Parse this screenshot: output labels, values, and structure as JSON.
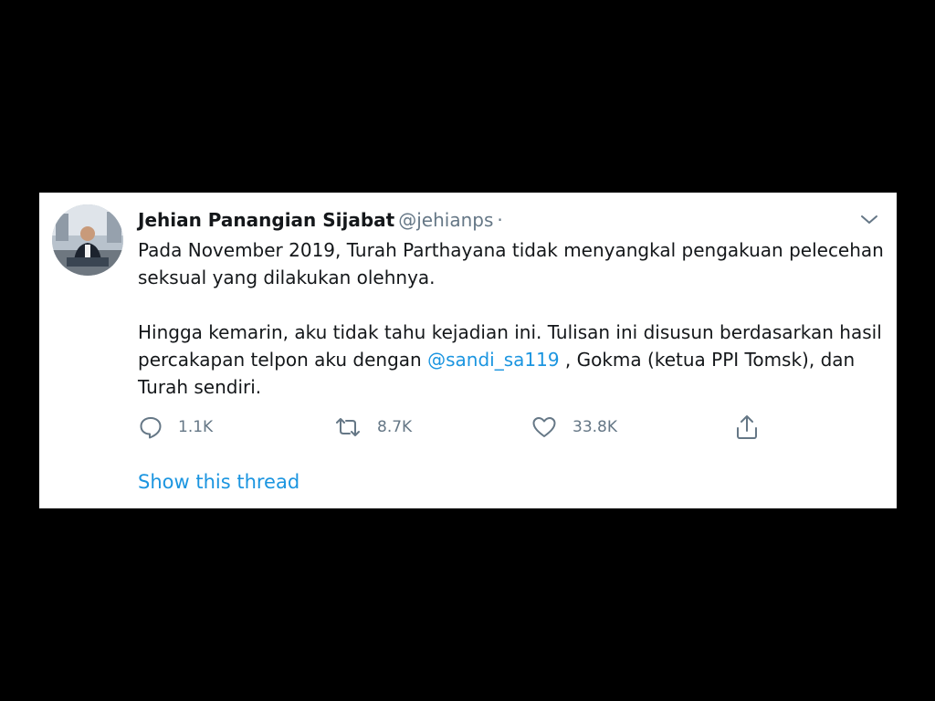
{
  "tweet": {
    "author": {
      "display_name": "Jehian Panangian Sijabat",
      "handle": "@jehianps",
      "separator": "·"
    },
    "text": {
      "p1": "Pada November 2019, Turah Parthayana tidak menyangkal pengakuan pelecehan seksual yang dilakukan olehnya.",
      "p2_before": "Hingga kemarin, aku tidak tahu kejadian ini. Tulisan ini disusun berdasarkan hasil percakapan telpon aku dengan ",
      "p2_mention": "@sandi_sa119",
      "p2_after": " , Gokma (ketua PPI Tomsk), dan Turah sendiri."
    },
    "actions": {
      "reply_count": "1.1K",
      "retweet_count": "8.7K",
      "like_count": "33.8K"
    },
    "show_thread_label": "Show this thread"
  },
  "colors": {
    "accent": "#1b95e0",
    "secondary_text": "#657786",
    "primary_text": "#14171a",
    "background": "#000000",
    "card": "#ffffff"
  },
  "icons": {
    "reply": "speech-bubble-icon",
    "retweet": "retweet-arrows-icon",
    "like": "heart-icon",
    "share": "upload-arrow-icon",
    "caret": "chevron-down-icon"
  }
}
